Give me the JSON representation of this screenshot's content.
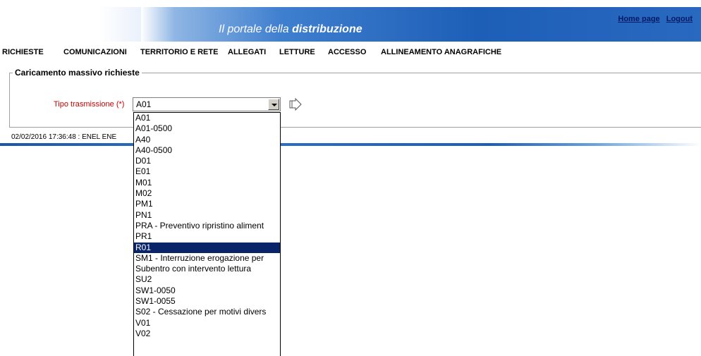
{
  "header": {
    "title_light": "Il portale della ",
    "title_bold": "distribuzione",
    "links": [
      "Home page",
      "Logout"
    ]
  },
  "menu": [
    "RICHIESTE",
    "COMUNICAZIONI",
    "TERRITORIO E RETE",
    "ALLEGATI",
    "LETTURE",
    "ACCESSO",
    "ALLINEAMENTO ANAGRAFICHE"
  ],
  "form": {
    "legend": "Caricamento massivo richieste",
    "tipo_label": "Tipo trasmissione (*)",
    "selected": "A01"
  },
  "status": "02/02/2016 17:36:48  :  ENEL ENE",
  "dropdown": {
    "options": [
      "A01",
      "A01-0500",
      "A40",
      "A40-0500",
      "D01",
      "E01",
      "M01",
      "M02",
      "PM1",
      "PN1",
      "PRA - Preventivo ripristino aliment",
      "PR1",
      "R01",
      "SM1 - Interruzione erogazione per",
      "Subentro con intervento lettura",
      "SU2",
      "SW1-0050",
      "SW1-0055",
      "S02 - Cessazione per motivi divers",
      "V01",
      "V02"
    ],
    "highlighted": "R01"
  },
  "colors": {
    "accent": "#1d5eb7",
    "label_red": "#cc0000",
    "highlight": "#0a246a"
  }
}
